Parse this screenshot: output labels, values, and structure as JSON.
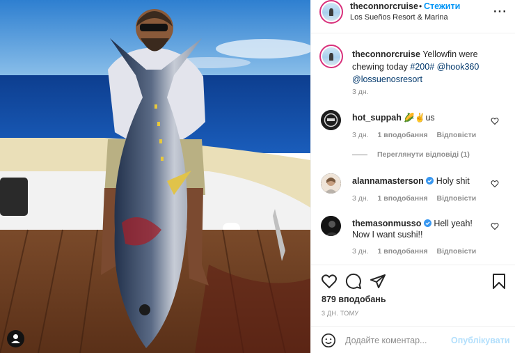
{
  "post": {
    "username": "theconnorcruise",
    "dot": "•",
    "follow_label": "Стежити",
    "location": "Los Sueños Resort & Marina",
    "more_icon": "more-horizontal-icon"
  },
  "caption": {
    "username": "theconnorcruise",
    "text": "Yellowfin were chewing today",
    "hashtag": "#200#",
    "mention1": "@hook360",
    "mention2": "@lossuenosresort",
    "time": "3 дн."
  },
  "comments": [
    {
      "username": "hot_suppah",
      "text": "🌽✌️us",
      "time": "3 дн.",
      "likes": "1 вподобання",
      "reply": "Відповісти"
    },
    {
      "username": "alannamasterson",
      "verified": true,
      "text": "Holy shit",
      "time": "3 дн.",
      "likes": "1 вподобання",
      "reply": "Відповісти"
    },
    {
      "username": "themasonmusso",
      "verified": true,
      "text": "Hell yeah! Now I want sushi!!",
      "time": "3 дн.",
      "likes": "1 вподобання",
      "reply": "Відповісти"
    }
  ],
  "view_replies": "Переглянути відповіді (1)",
  "actions": {
    "likes": "879 вподобань",
    "date": "3 ДН. ТОМУ"
  },
  "comment_box": {
    "placeholder": "Додайте коментар...",
    "publish_label": "Опублікувати"
  },
  "colors": {
    "link": "#00376b",
    "follow": "#0095f6",
    "verified": "#3897f0",
    "publish_disabled": "#b2dffc",
    "muted": "#8e8e8e"
  }
}
